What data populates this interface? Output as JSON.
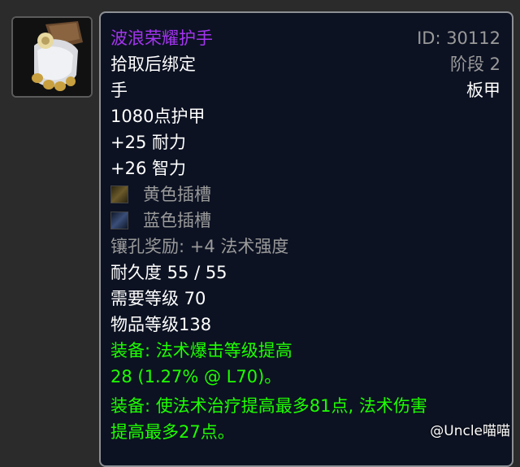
{
  "icon": {
    "name": "gauntlets-icon"
  },
  "item": {
    "name": "波浪荣耀护手",
    "id_text": "ID: 30112",
    "bind": "拾取后绑定",
    "stage": "阶段 2",
    "slot": "手",
    "armor_type": "板甲",
    "armor": "1080点护甲",
    "stam": "+25 耐力",
    "int": "+26 智力",
    "socket_yellow": "黄色插槽",
    "socket_blue": "蓝色插槽",
    "socket_bonus": "镶孔奖励: +4 法术强度",
    "durability": "耐久度 55 / 55",
    "req_level": "需要等级 70",
    "item_level": "物品等级138",
    "equip1_a": "装备:  法术爆击等级提高",
    "equip1_b": "28 (1.27% @ L70)。",
    "equip2_a": "装备:  使法术治疗提高最多81点, 法术伤害",
    "equip2_b": "提高最多27点。"
  },
  "watermark": "@Uncle喵喵",
  "colors": {
    "epic": "#a335ee",
    "green": "#1eff00",
    "grey": "#9a9a9a",
    "bg": "#0c1222"
  }
}
